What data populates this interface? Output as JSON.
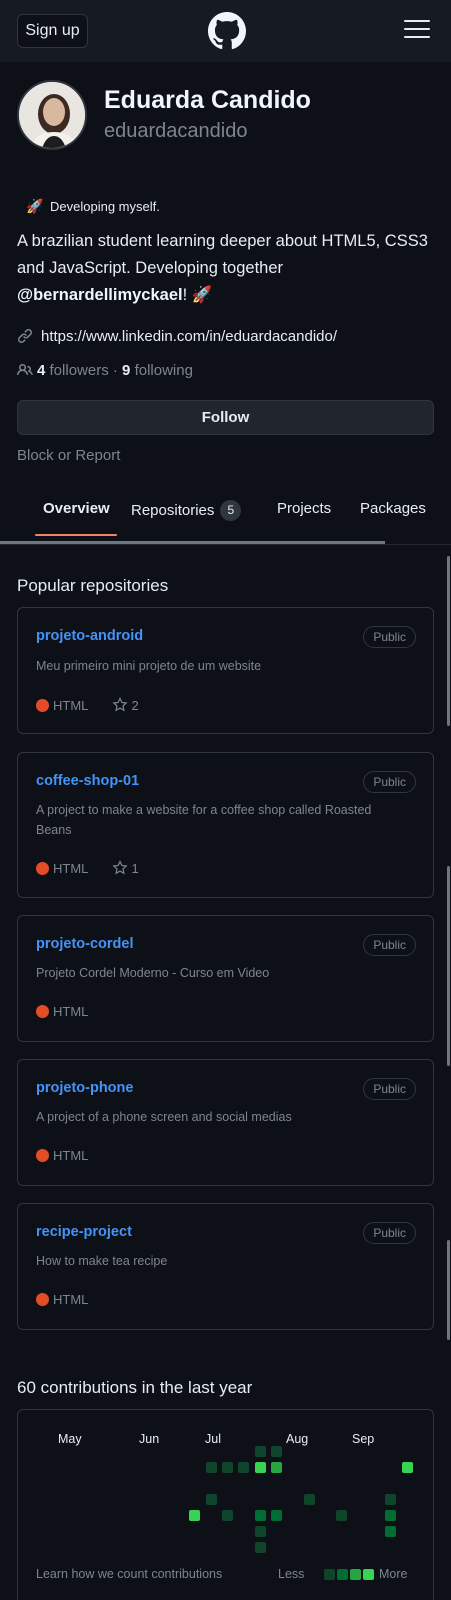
{
  "header": {
    "signup_label": "Sign up",
    "logo_icon": "github-mark-icon",
    "menu_icon": "hamburger-menu-icon"
  },
  "profile": {
    "name": "Eduarda Candido",
    "login": "eduardacandido",
    "status_emoji": "🚀",
    "status_text": "Developing myself.",
    "bio_line1": "A brazilian student learning deeper about HTML5, CSS3 and JavaScript. Developing together ",
    "bio_mention": "@bernardellimyckael",
    "bio_end": "! 🚀",
    "website": "https://www.linkedin.com/in/eduardacandido/",
    "followers_count": "4",
    "followers_label": "followers",
    "separator": "·",
    "following_count": "9",
    "following_label": "following",
    "follow_label": "Follow",
    "block_label": "Block or Report"
  },
  "tabs": [
    {
      "label": "Overview",
      "active": true
    },
    {
      "label": "Repositories",
      "count": "5"
    },
    {
      "label": "Projects"
    },
    {
      "label": "Packages"
    }
  ],
  "popular": {
    "title": "Popular repositories",
    "repos": [
      {
        "name": "projeto-android",
        "visibility": "Public",
        "description": "Meu primeiro mini projeto de um website",
        "language": "HTML",
        "stars": "2"
      },
      {
        "name": "coffee-shop-01",
        "visibility": "Public",
        "description": "A project to make a website for a coffee shop called Roasted Beans",
        "language": "HTML",
        "stars": "1"
      },
      {
        "name": "projeto-cordel",
        "visibility": "Public",
        "description": "Projeto Cordel Moderno - Curso em Video",
        "language": "HTML"
      },
      {
        "name": "projeto-phone",
        "visibility": "Public",
        "description": "A project of a phone screen and social medias",
        "language": "HTML"
      },
      {
        "name": "recipe-project",
        "visibility": "Public",
        "description": "How to make tea recipe",
        "language": "HTML"
      }
    ]
  },
  "contributions": {
    "title": "60 contributions in the last year",
    "months": [
      "May",
      "Jun",
      "Jul",
      "Aug",
      "Sep"
    ],
    "learn_label": "Learn how we count contributions",
    "less_label": "Less",
    "more_label": "More",
    "colors": {
      "level1": "#0e4429",
      "level2": "#006d32",
      "level3": "#26a641",
      "level4": "#39d353",
      "language_html": "#e34c26"
    }
  }
}
